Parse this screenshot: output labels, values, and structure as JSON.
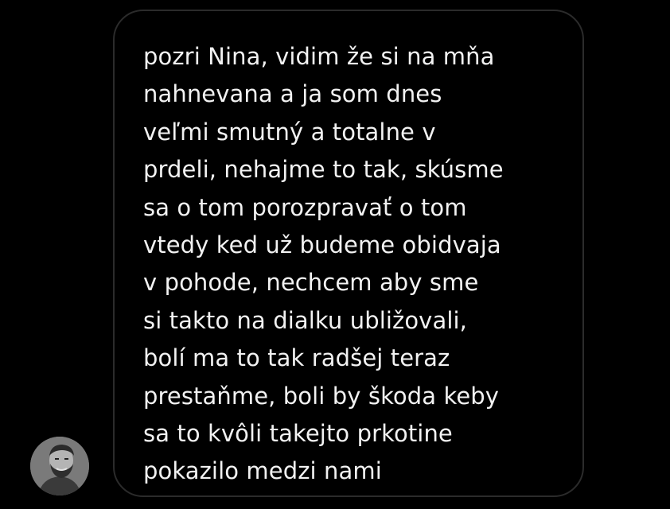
{
  "message": {
    "text": "pozri Nina, vidim že si na mňa\nnahnevana a ja som dnes\nveľmi smutný a totalne v\nprdeli, nehajme to tak, skúsme\nsa o tom porozpravať o tom\nvtedy ked už budeme obidvaja\nv pohode, nechcem aby sme\nsi takto na dialku ubližovali,\nbolí ma to tak radšej teraz\nprestaňme, boli by škoda keby\nsa to kvôli takejto prkotine\npokazilo medzi nami"
  },
  "sender": {
    "avatar_icon": "profile-photo-icon"
  },
  "colors": {
    "background": "#000000",
    "bubble_border": "#2b2b2b",
    "text": "#f2f2f2"
  }
}
